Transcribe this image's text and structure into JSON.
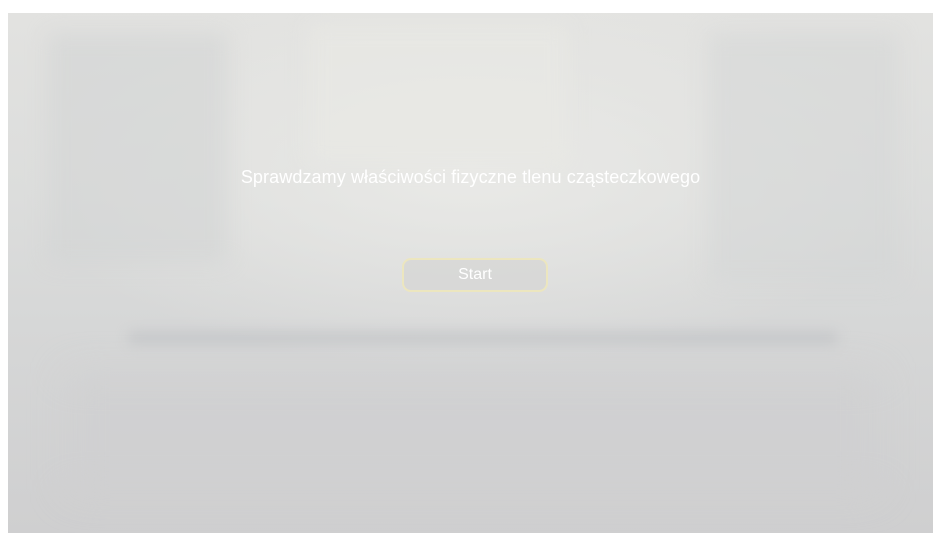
{
  "screen": {
    "title": "Sprawdzamy właściwości fizyczne tlenu cząsteczkowego",
    "start_label": "Start"
  },
  "colors": {
    "text": "#ffffff",
    "button_border": "#ece6bf",
    "background": "#dcdddc"
  }
}
